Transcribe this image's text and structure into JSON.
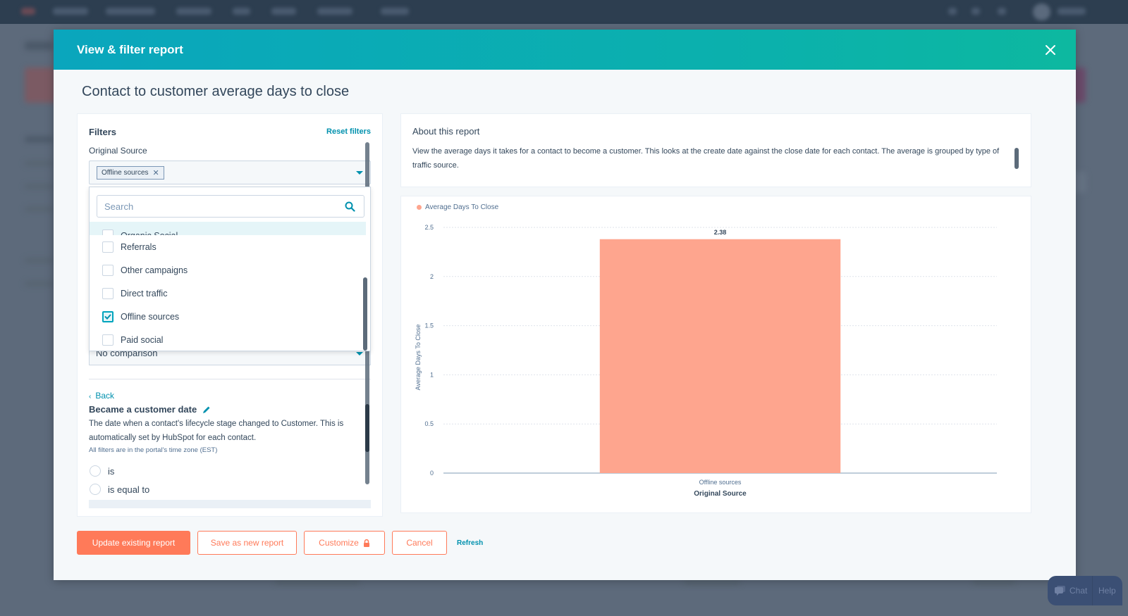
{
  "modal": {
    "title": "View & filter report",
    "close_icon": "close-icon",
    "report_title": "Contact to customer average days to close"
  },
  "filters": {
    "heading": "Filters",
    "reset_label": "Reset filters",
    "original_source": {
      "label": "Original Source",
      "selected_tag": "Offline sources",
      "dropdown": {
        "search_placeholder": "Search",
        "options": [
          {
            "label": "Organic Social",
            "checked": false
          },
          {
            "label": "Referrals",
            "checked": false
          },
          {
            "label": "Other campaigns",
            "checked": false
          },
          {
            "label": "Direct traffic",
            "checked": false
          },
          {
            "label": "Offline sources",
            "checked": true
          },
          {
            "label": "Paid social",
            "checked": false
          }
        ]
      }
    },
    "comparison_value": "No comparison",
    "property": {
      "back_label": "Back",
      "title": "Became a customer date",
      "description": "The date when a contact's lifecycle stage changed to Customer. This is automatically set by HubSpot for each contact.",
      "timezone_note": "All filters are in the portal's time zone (EST)",
      "operators": [
        "is",
        "is equal to"
      ]
    }
  },
  "about": {
    "title": "About this report",
    "text": "View the average days it takes for a contact to become a customer. This looks at the create date against the close date for each contact. The average is grouped by type of traffic source."
  },
  "chart_data": {
    "type": "bar",
    "title": "",
    "legend": [
      "Average Days To Close"
    ],
    "legend_position": "top-left",
    "categories": [
      "Offline sources"
    ],
    "series": [
      {
        "name": "Average Days To Close",
        "values": [
          2.38
        ],
        "color": "#fea58e"
      }
    ],
    "data_labels": [
      "2.38"
    ],
    "xlabel": "Original Source",
    "ylabel": "Average Days To Close",
    "ylim": [
      0,
      2.5
    ],
    "yticks": [
      0,
      0.5,
      1,
      1.5,
      2,
      2.5
    ],
    "ytick_labels": [
      "0",
      "0.5",
      "1",
      "1.5",
      "2",
      "2.5"
    ],
    "grid": true
  },
  "footer": {
    "update_label": "Update existing report",
    "save_new_label": "Save as new report",
    "customize_label": "Customize",
    "cancel_label": "Cancel",
    "refresh_label": "Refresh"
  },
  "chat_widget": {
    "chat_label": "Chat",
    "help_label": "Help"
  },
  "colors": {
    "header_gradient_start": "#0aa6bd",
    "header_gradient_end": "#0db8a0",
    "accent": "#ff7a59",
    "link": "#0091ae",
    "bar": "#fea58e"
  }
}
